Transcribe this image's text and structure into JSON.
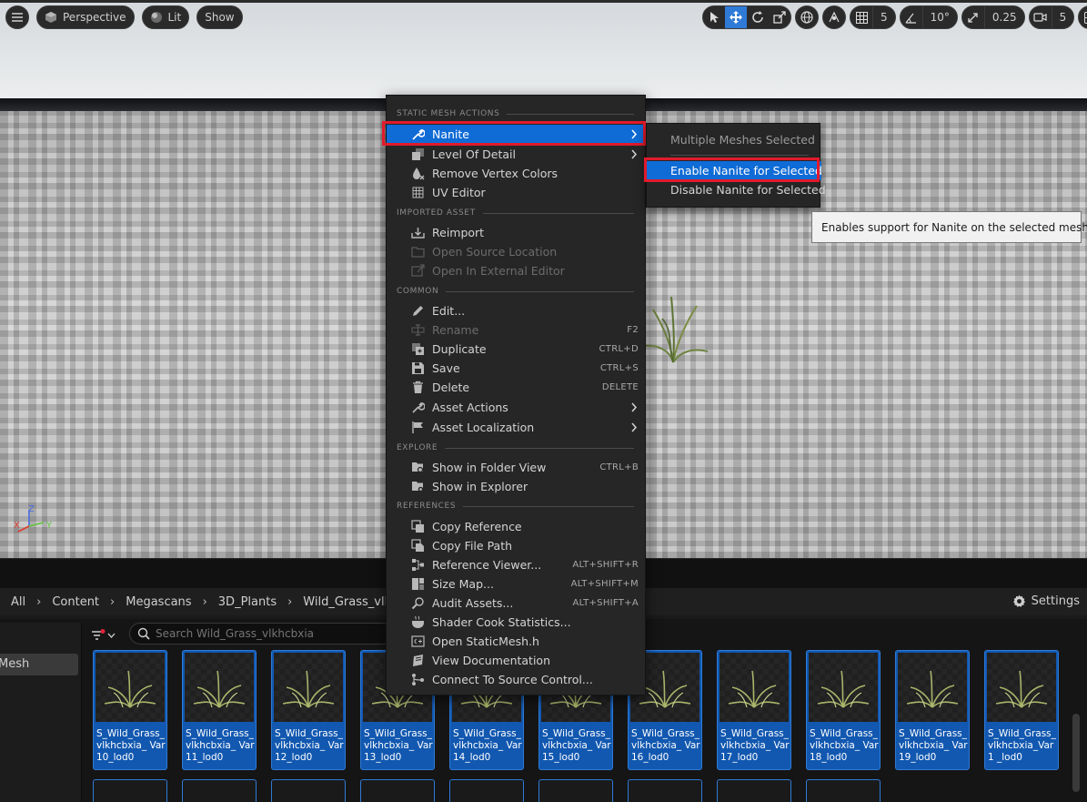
{
  "viewport": {
    "toolbar": {
      "perspective_label": "Perspective",
      "lit_label": "Lit",
      "show_label": "Show",
      "grid_snap_value": "5",
      "rotation_snap_value": "10°",
      "scale_snap_value": "0.25",
      "camera_speed_value": "5"
    },
    "axis": {
      "x": "X",
      "y": "Y",
      "z": "Z"
    }
  },
  "context_menu": {
    "sections": {
      "static_mesh_actions": "STATIC MESH ACTIONS",
      "imported_asset": "IMPORTED ASSET",
      "common": "COMMON",
      "explore": "EXPLORE",
      "references": "REFERENCES"
    },
    "items": {
      "nanite": "Nanite",
      "level_of_detail": "Level Of Detail",
      "remove_vertex_colors": "Remove Vertex Colors",
      "uv_editor": "UV Editor",
      "reimport": "Reimport",
      "open_source_location": "Open Source Location",
      "open_in_external_editor": "Open In External Editor",
      "edit": "Edit...",
      "rename": "Rename",
      "rename_shortcut": "F2",
      "duplicate": "Duplicate",
      "duplicate_shortcut": "CTRL+D",
      "save": "Save",
      "save_shortcut": "CTRL+S",
      "delete": "Delete",
      "delete_shortcut": "DELETE",
      "asset_actions": "Asset Actions",
      "asset_localization": "Asset Localization",
      "show_in_folder_view": "Show in Folder View",
      "show_in_folder_view_shortcut": "CTRL+B",
      "show_in_explorer": "Show in Explorer",
      "copy_reference": "Copy Reference",
      "copy_file_path": "Copy File Path",
      "reference_viewer": "Reference Viewer...",
      "reference_viewer_shortcut": "ALT+SHIFT+R",
      "size_map": "Size Map...",
      "size_map_shortcut": "ALT+SHIFT+M",
      "audit_assets": "Audit Assets...",
      "audit_assets_shortcut": "ALT+SHIFT+A",
      "shader_cook_statistics": "Shader Cook Statistics...",
      "open_staticmesh_h": "Open StaticMesh.h",
      "view_documentation": "View Documentation",
      "connect_to_source_control": "Connect To Source Control..."
    }
  },
  "submenu": {
    "header": "Multiple Meshes Selected",
    "enable": "Enable Nanite for Selected",
    "disable": "Disable Nanite for Selected"
  },
  "tooltip": {
    "text": "Enables support for Nanite on the selected meshes."
  },
  "content_browser": {
    "breadcrumb": [
      "All",
      "Content",
      "Megascans",
      "3D_Plants",
      "Wild_Grass_vlkhc"
    ],
    "settings_label": "Settings",
    "search_placeholder": "Search Wild_Grass_vlkhcbxia",
    "sources_item": "Mesh",
    "tiles": [
      "S_Wild_Grass_ vlkhcbxia_ Var10_lod0",
      "S_Wild_Grass_ vlkhcbxia_ Var11_lod0",
      "S_Wild_Grass_ vlkhcbxia_ Var12_lod0",
      "S_Wild_Grass_ vlkhcbxia_ Var13_lod0",
      "S_Wild_Grass_ vlkhcbxia_ Var14_lod0",
      "S_Wild_Grass_ vlkhcbxia_ Var15_lod0",
      "S_Wild_Grass_ vlkhcbxia_ Var16_lod0",
      "S_Wild_Grass_ vlkhcbxia_ Var17_lod0",
      "S_Wild_Grass_ vlkhcbxia_ Var18_lod0",
      "S_Wild_Grass_ vlkhcbxia_ Var19_lod0",
      "S_Wild_Grass_ vlkhcbxia_Var1 _lod0"
    ]
  },
  "colors": {
    "highlight": "#0f6bd6",
    "annotation_red": "#e11a2b",
    "menu_bg": "#262626",
    "tile_selected": "#1258b0"
  }
}
